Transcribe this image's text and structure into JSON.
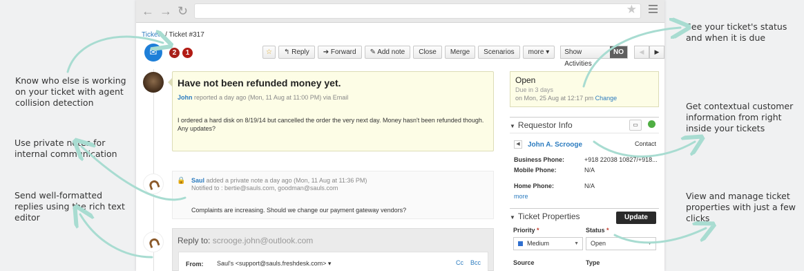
{
  "callouts": {
    "collision": "Know who else is working\non your ticket with agent\ncollision detection",
    "private_notes": "Use private notes for\ninternal communication",
    "rich_text": "Send well-formatted\nreplies using the rich text\neditor",
    "status": "See your ticket's status\nand when it is due",
    "contextual": "Get contextual customer\ninformation from right\ninside your tickets",
    "properties": "View and manage ticket\nproperties with just a few\nclicks"
  },
  "browser": {
    "back": "←",
    "forward": "→",
    "reload": "↻",
    "bookmark": "★"
  },
  "breadcrumb": {
    "tickets": "Tickets",
    "separator": "/",
    "current": "Ticket #317"
  },
  "badges": [
    "2",
    "1"
  ],
  "toolbar": {
    "star": "☆",
    "reply": "Reply",
    "forward": "Forward",
    "add_note": "Add note",
    "close": "Close",
    "merge": "Merge",
    "scenarios": "Scenarios",
    "more": "more ▾",
    "show_activities": "Show Activities",
    "show_activities_value": "NO",
    "prev": "◀",
    "next": "▶"
  },
  "ticket": {
    "subject": "Have not been refunded money yet.",
    "author": "John",
    "meta": " reported a day ago (Mon, 11 Aug at 11:00 PM) via Email",
    "body": "I ordered a hard disk on 8/19/14 but cancelled the order the very next day. Money hasn't been refunded though. Any updates?"
  },
  "note": {
    "author": "Saul",
    "meta": " added a private note a day ago (Mon, 11 Aug at 11:36 PM)",
    "notified": "Notified to : bertie@sauls.com, goodman@sauls.com",
    "body": "Complaints are increasing. Should we change our payment gateway vendors?"
  },
  "reply": {
    "label": "Reply to:",
    "to": "scrooge.john@outlook.com",
    "from_label": "From:",
    "from_value": "Saul's <support@sauls.freshdesk.com>  ▾",
    "cc": "Cc",
    "bcc": "Bcc"
  },
  "status": {
    "value": "Open",
    "due": "Due in 3 days",
    "date": "on Mon, 25 Aug at 12:17 pm ",
    "change": "Change"
  },
  "requestor": {
    "title": "Requestor Info",
    "name": "John A. Scrooge",
    "contact": "Contact",
    "fields": [
      {
        "label": "Business Phone:",
        "value": "+918 22038 10827/+918..."
      },
      {
        "label": "Mobile Phone:",
        "value": "N/A"
      },
      {
        "label": "Home Phone:",
        "value": "N/A"
      }
    ],
    "more": "more"
  },
  "properties": {
    "title": "Ticket Properties",
    "update": "Update",
    "priority_label": "Priority",
    "status_label": "Status",
    "required": "*",
    "priority_value": "Medium",
    "status_value": "Open",
    "source_label": "Source",
    "type_label": "Type"
  },
  "colors": {
    "accent": "#2b7bbf",
    "arrow": "#a8dcd1",
    "badge": "#a8201a"
  }
}
